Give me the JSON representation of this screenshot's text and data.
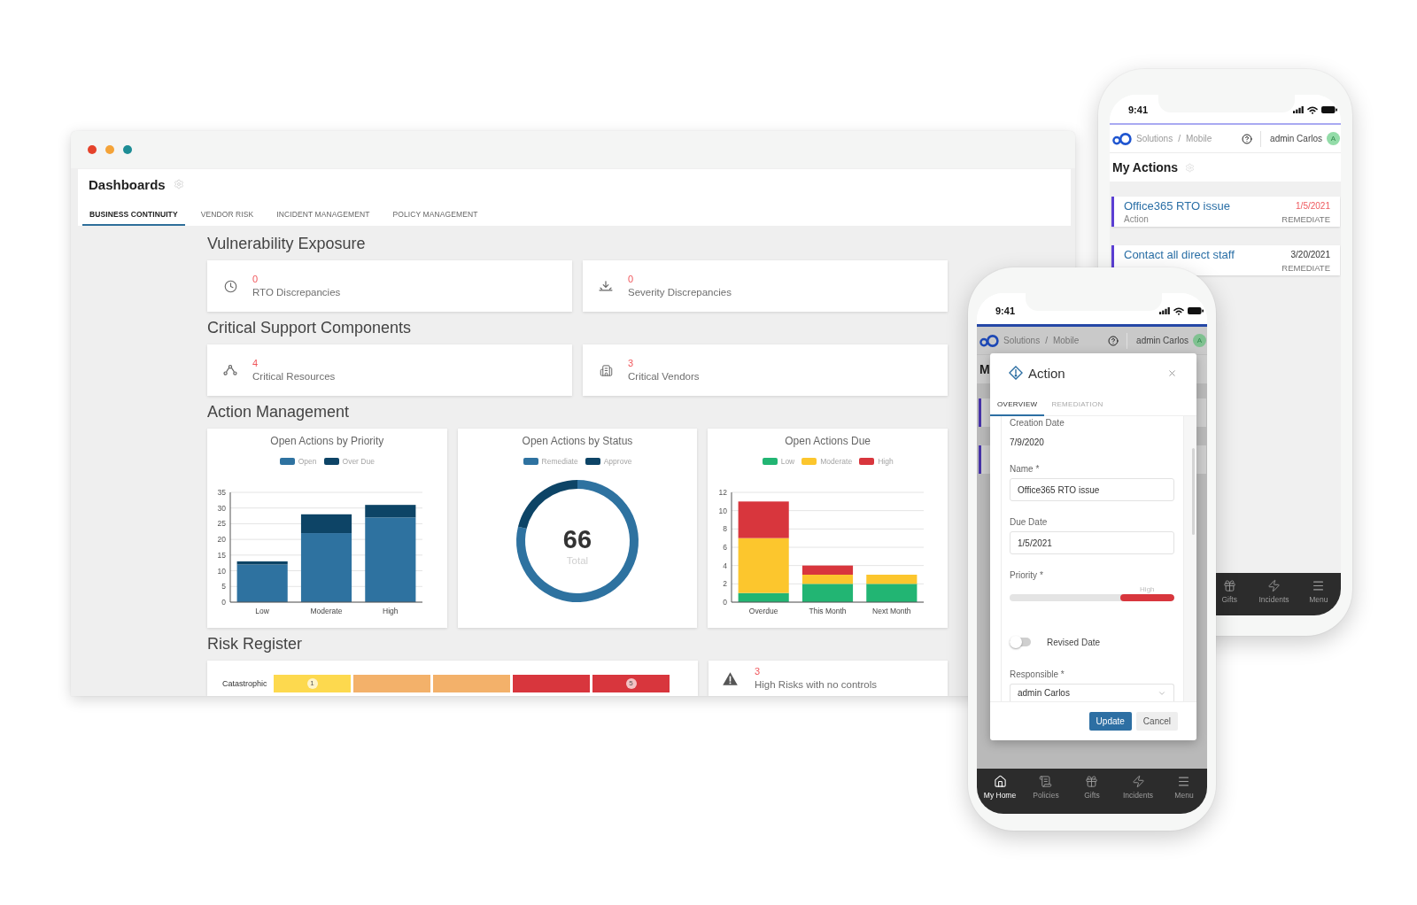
{
  "desktop": {
    "title": "Dashboards",
    "tabs": [
      {
        "label": "BUSINESS CONTINUITY",
        "selected": true
      },
      {
        "label": "VENDOR RISK",
        "selected": false
      },
      {
        "label": "INCIDENT MANAGEMENT",
        "selected": false
      },
      {
        "label": "POLICY MANAGEMENT",
        "selected": false
      }
    ],
    "sections": [
      {
        "kind": "stats",
        "title": "Vulnerability Exposure",
        "cards": [
          {
            "value": "0",
            "label": "RTO Discrepancies"
          },
          {
            "value": "0",
            "label": "Severity Discrepancies"
          }
        ]
      },
      {
        "kind": "stats",
        "title": "Critical Support Components",
        "cards": [
          {
            "value": "4",
            "label": "Critical Resources"
          },
          {
            "value": "3",
            "label": "Critical Vendors"
          }
        ]
      },
      {
        "kind": "charts",
        "title": "Action Management",
        "charts": [
          {
            "chart_data": {
              "type": "bar",
              "title": "Open Actions by Priority",
              "categories": [
                "Low",
                "Moderate",
                "High"
              ],
              "stacked": true,
              "series": [
                {
                  "name": "Open",
                  "color": "#2e72a0",
                  "values": [
                    12,
                    22,
                    27
                  ]
                },
                {
                  "name": "Over Due",
                  "color": "#0d4466",
                  "values": [
                    1,
                    6,
                    4
                  ]
                }
              ],
              "ylim": [
                0,
                35
              ],
              "yticks": [
                0,
                5,
                10,
                15,
                20,
                25,
                30,
                35
              ],
              "grid": true,
              "legend": true
            }
          },
          {
            "center_value": "66",
            "center_label": "Total",
            "chart_data": {
              "type": "donut",
              "title": "Open Actions by Status",
              "categories": [
                "Remediate",
                "Approve"
              ],
              "values": [
                78.8,
                21.2
              ],
              "colors": [
                "#2e72a0",
                "#0d4466"
              ],
              "legend": true
            }
          },
          {
            "chart_data": {
              "type": "bar",
              "title": "Open Actions Due",
              "categories": [
                "Overdue",
                "This Month",
                "Next Month"
              ],
              "stacked": true,
              "series": [
                {
                  "name": "Low",
                  "color": "#22b573",
                  "values": [
                    1,
                    2,
                    2
                  ]
                },
                {
                  "name": "Moderate",
                  "color": "#fcc62d",
                  "values": [
                    6,
                    1,
                    1
                  ]
                },
                {
                  "name": "High",
                  "color": "#d8363d",
                  "values": [
                    4,
                    1,
                    0
                  ]
                }
              ],
              "ylim": [
                0,
                12
              ],
              "yticks": [
                0,
                2,
                4,
                6,
                8,
                10,
                12
              ],
              "grid": true,
              "legend": true
            }
          }
        ]
      },
      {
        "kind": "risk",
        "title": "Risk Register",
        "heatmap": {
          "rows": [
            {
              "label": "Catastrophic",
              "cells": [
                {
                  "color": "#fdd94e",
                  "badge": "1"
                },
                {
                  "color": "#f3b16a"
                },
                {
                  "color": "#f3b16a"
                },
                {
                  "color": "#d8363d"
                },
                {
                  "color": "#d8363d",
                  "badge": "5"
                }
              ]
            }
          ]
        },
        "alert": {
          "value": "3",
          "label": "High Risks with no controls"
        }
      }
    ]
  },
  "back_phone": {
    "time": "9:41",
    "breadcrumb": [
      "Solutions",
      "Mobile"
    ],
    "breadcrumb_separator": "/",
    "user": "admin Carlos",
    "avatar": "A",
    "page_title": "My Actions",
    "actions": [
      {
        "title": "Office365 RTO issue",
        "subtitle": "Action",
        "date": "1/5/2021",
        "overdue": true,
        "status": "REMEDIATE"
      },
      {
        "title": "Contact all direct staff",
        "date": "3/20/2021",
        "overdue": false,
        "status": "REMEDIATE"
      }
    ],
    "nav": [
      {
        "label": "Gifts",
        "selected": false
      },
      {
        "label": "Incidents",
        "selected": false
      },
      {
        "label": "Menu",
        "selected": false
      }
    ]
  },
  "front_phone": {
    "time": "9:41",
    "breadcrumb": [
      "Solutions",
      "Mobile"
    ],
    "breadcrumb_separator": "/",
    "user": "admin Carlos",
    "avatar": "A",
    "page_title": "M",
    "modal": {
      "title": "Action",
      "tabs": [
        {
          "label": "OVERVIEW",
          "selected": true
        },
        {
          "label": "REMEDIATION",
          "selected": false
        }
      ],
      "fields": [
        {
          "kind": "static",
          "label": "Creation Date",
          "value": "7/9/2020"
        },
        {
          "kind": "text",
          "label": "Name *",
          "value": "Office365 RTO issue"
        },
        {
          "kind": "text",
          "label": "Due Date",
          "value": "1/5/2021"
        },
        {
          "kind": "slider",
          "label": "Priority *",
          "reading": "High",
          "level": 0.33
        },
        {
          "kind": "toggle",
          "label": "Revised Date",
          "on": false
        },
        {
          "kind": "select",
          "label": "Responsible *",
          "value": "admin Carlos"
        }
      ],
      "buttons": [
        {
          "label": "Update",
          "kind": "primary"
        },
        {
          "label": "Cancel",
          "kind": "secondary"
        }
      ]
    },
    "nav": [
      {
        "label": "My Home",
        "selected": true
      },
      {
        "label": "Policies",
        "selected": false
      },
      {
        "label": "Gifts",
        "selected": false
      },
      {
        "label": "Incidents",
        "selected": false
      },
      {
        "label": "Menu",
        "selected": false
      }
    ]
  }
}
